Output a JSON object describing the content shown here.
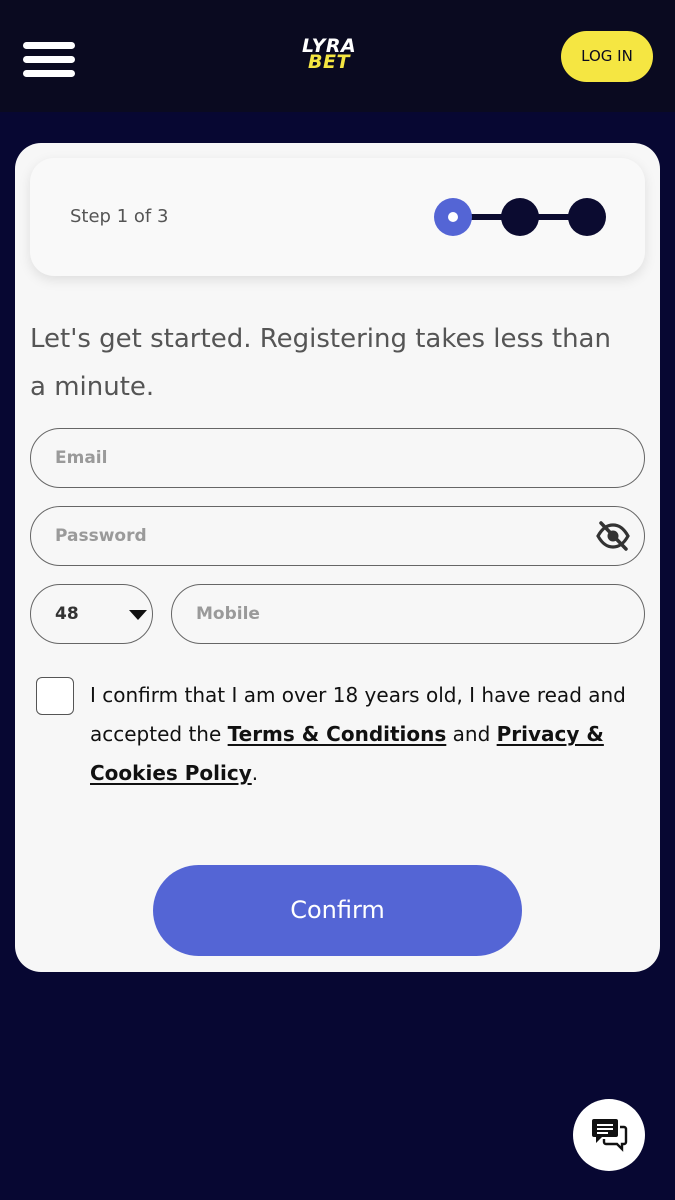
{
  "header": {
    "logo_top": "LYRA",
    "logo_bottom": "BET",
    "login_label": "LOG IN",
    "menu_icon": "hamburger-icon"
  },
  "steps": {
    "label": "Step 1 of 3",
    "current": 1,
    "total": 3
  },
  "form": {
    "intro": "Let's get started. Registering takes less than a minute.",
    "email_placeholder": "Email",
    "password_placeholder": "Password",
    "password_icon": "eye-off-icon",
    "country_code": "48",
    "mobile_placeholder": "Mobile",
    "consent_prefix": "I confirm that I am over 18 years old, I have read and accepted the ",
    "terms_link": "Terms & Conditions",
    "consent_and": " and ",
    "privacy_link": "Privacy & Cookies Policy",
    "consent_suffix": ".",
    "confirm_label": "Confirm"
  },
  "chat": {
    "icon": "chat-icon"
  },
  "colors": {
    "background": "#070732",
    "topbar": "#0a0a20",
    "accent_yellow": "#f5e642",
    "primary_blue": "#5465d5",
    "card": "#f7f7f7"
  }
}
